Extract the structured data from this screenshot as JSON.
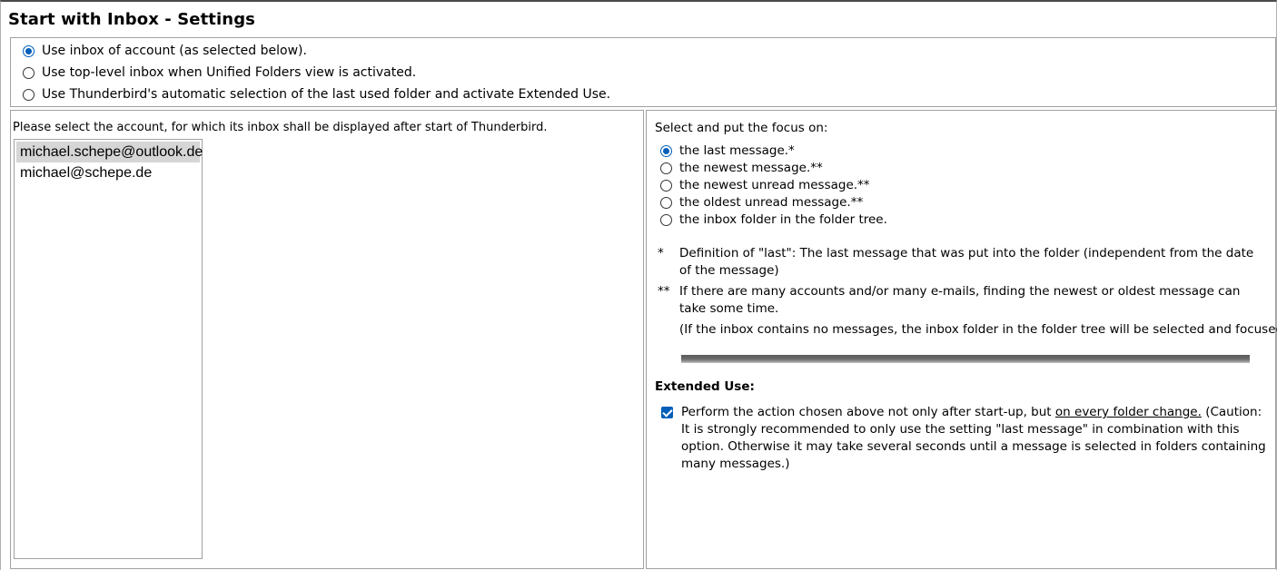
{
  "title": "Start with Inbox - Settings",
  "top_options": [
    {
      "label": "Use inbox of account (as selected below).",
      "checked": true
    },
    {
      "label": "Use top-level inbox when Unified Folders view is activated.",
      "checked": false
    },
    {
      "label": "Use Thunderbird's automatic selection of the last used folder and activate Extended Use.",
      "checked": false
    }
  ],
  "account_prompt": "Please select the account, for which its inbox shall be displayed after start of Thunderbird.",
  "accounts": [
    {
      "label": "michael.schepe@outlook.de",
      "selected": true
    },
    {
      "label": "michael@schepe.de",
      "selected": false
    }
  ],
  "focus": {
    "title": "Select and put the focus on:",
    "options": [
      {
        "label": "the last message.*",
        "checked": true
      },
      {
        "label": "the newest message.**",
        "checked": false
      },
      {
        "label": "the newest unread message.**",
        "checked": false
      },
      {
        "label": "the oldest unread message.**",
        "checked": false
      },
      {
        "label": "the inbox folder in the folder tree.",
        "checked": false
      }
    ]
  },
  "notes": {
    "mark1": "*",
    "note1": "Definition of \"last\": The last message that was put into the folder (independent from the date of the message)",
    "mark2": "**",
    "note2": "If there are many accounts and/or many e-mails, finding the newest or oldest message can take some time.",
    "note3": "(If the inbox contains no messages, the inbox folder in the folder tree will be selected and focused.)"
  },
  "extended": {
    "title": "Extended Use:",
    "checked": true,
    "text_before": "Perform the action chosen above not only after start-up, but ",
    "text_link": "on every folder change.",
    "text_after": " (Caution: It is strongly recommended to only use the setting \"last message\" in combination with this option. Otherwise it may take several seconds until a message is selected in folders containing many messages.)"
  },
  "colors": {
    "accent": "#005fb8",
    "selection": "#d6d6d6",
    "border": "#a0a0a0"
  }
}
